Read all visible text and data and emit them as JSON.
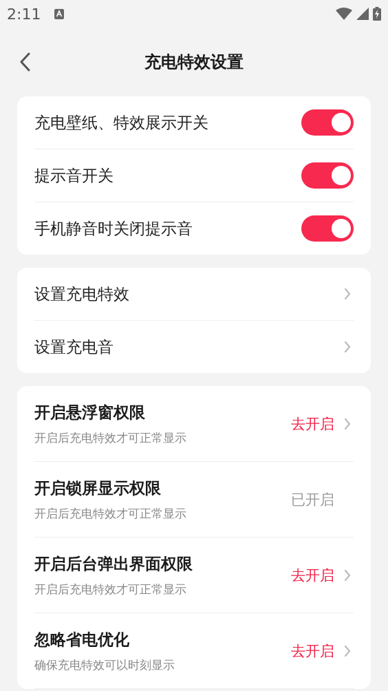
{
  "status_bar": {
    "time": "2:11"
  },
  "header": {
    "title": "充电特效设置"
  },
  "toggles": [
    {
      "label": "充电壁纸、特效展示开关",
      "on": true
    },
    {
      "label": "提示音开关",
      "on": true
    },
    {
      "label": "手机静音时关闭提示音",
      "on": true
    }
  ],
  "links": [
    {
      "label": "设置充电特效"
    },
    {
      "label": "设置充电音"
    }
  ],
  "permissions": [
    {
      "title": "开启悬浮窗权限",
      "subtitle": "开启后充电特效才可正常显示",
      "status": "去开启",
      "granted": false
    },
    {
      "title": "开启锁屏显示权限",
      "subtitle": "开启后充电特效才可正常显示",
      "status": "已开启",
      "granted": true
    },
    {
      "title": "开启后台弹出界面权限",
      "subtitle": "开启后充电特效才可正常显示",
      "status": "去开启",
      "granted": false
    },
    {
      "title": "忽略省电优化",
      "subtitle": "确保充电特效可以时刻显示",
      "status": "去开启",
      "granted": false
    }
  ]
}
